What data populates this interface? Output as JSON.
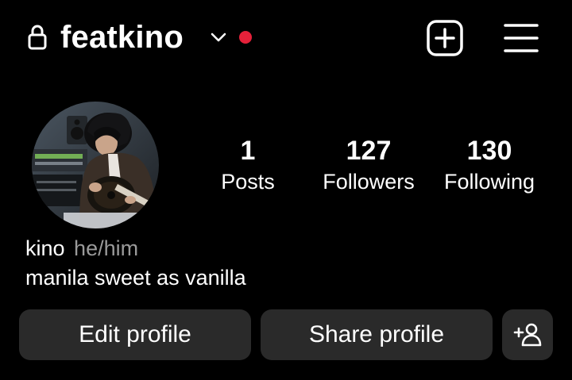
{
  "header": {
    "username": "featkino",
    "lock_icon": "lock-icon",
    "dropdown_icon": "chevron-down-icon",
    "notification_dot_color": "#e5213a",
    "new_post_icon": "plus-square-icon",
    "menu_icon": "hamburger-menu-icon"
  },
  "profile": {
    "avatar_icon": "profile-photo",
    "stats": [
      {
        "value": "1",
        "label": "Posts"
      },
      {
        "value": "127",
        "label": "Followers"
      },
      {
        "value": "130",
        "label": "Following"
      }
    ],
    "display_name": "kino",
    "pronouns": "he/him",
    "bio": "manila sweet as vanilla"
  },
  "actions": {
    "edit_label": "Edit profile",
    "share_label": "Share profile",
    "discover_icon": "add-person-icon"
  },
  "colors": {
    "background": "#000000",
    "button_bg": "#2a2a2a",
    "secondary_text": "#9a9a9a"
  }
}
